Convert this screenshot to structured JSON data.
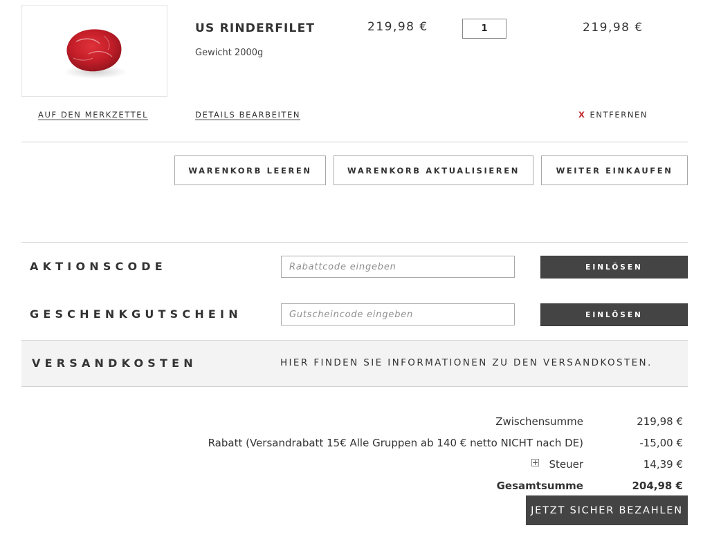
{
  "cart_item": {
    "image_alt": "US Rinderfilet",
    "name": "US RINDERFILET",
    "weight": "Gewicht 2000g",
    "unit_price": "219,98 €",
    "quantity": "1",
    "row_total": "219,98 €",
    "wishlist_link": "AUF DEN MERKZETTEL",
    "edit_link": "DETAILS BEARBEITEN",
    "remove_x": "X",
    "remove_label": "ENTFERNEN"
  },
  "cart_actions": {
    "clear": "WARENKORB LEEREN",
    "update": "WARENKORB AKTUALISIEREN",
    "continue": "WEITER EINKAUFEN"
  },
  "promo": {
    "label": "AKTIONSCODE",
    "placeholder": "Rabattcode eingeben",
    "button": "EINLÖSEN"
  },
  "giftcard": {
    "label": "GESCHENKGUTSCHEIN",
    "placeholder": "Gutscheincode eingeben",
    "button": "EINLÖSEN"
  },
  "shipping": {
    "label": "VERSANDKOSTEN",
    "info": "HIER FINDEN SIE INFORMATIONEN ZU DEN VERSANDKOSTEN."
  },
  "totals": {
    "subtotal_label": "Zwischensumme",
    "subtotal_value": "219,98 €",
    "discount_label": "Rabatt (Versandrabatt 15€ Alle Gruppen ab 140 € netto NICHT nach DE)",
    "discount_value": "-15,00 €",
    "tax_label": "Steuer",
    "tax_value": "14,39 €",
    "grand_total_label": "Gesamtsumme",
    "grand_total_value": "204,98 €"
  },
  "checkout": {
    "button": "JETZT SICHER BEZAHLEN"
  },
  "colors": {
    "dark_button": "#444444",
    "remove_x": "#c1272d",
    "shipping_bg": "#f3f3f3"
  },
  "icons": {
    "tax_expand": "plus-box-icon"
  }
}
